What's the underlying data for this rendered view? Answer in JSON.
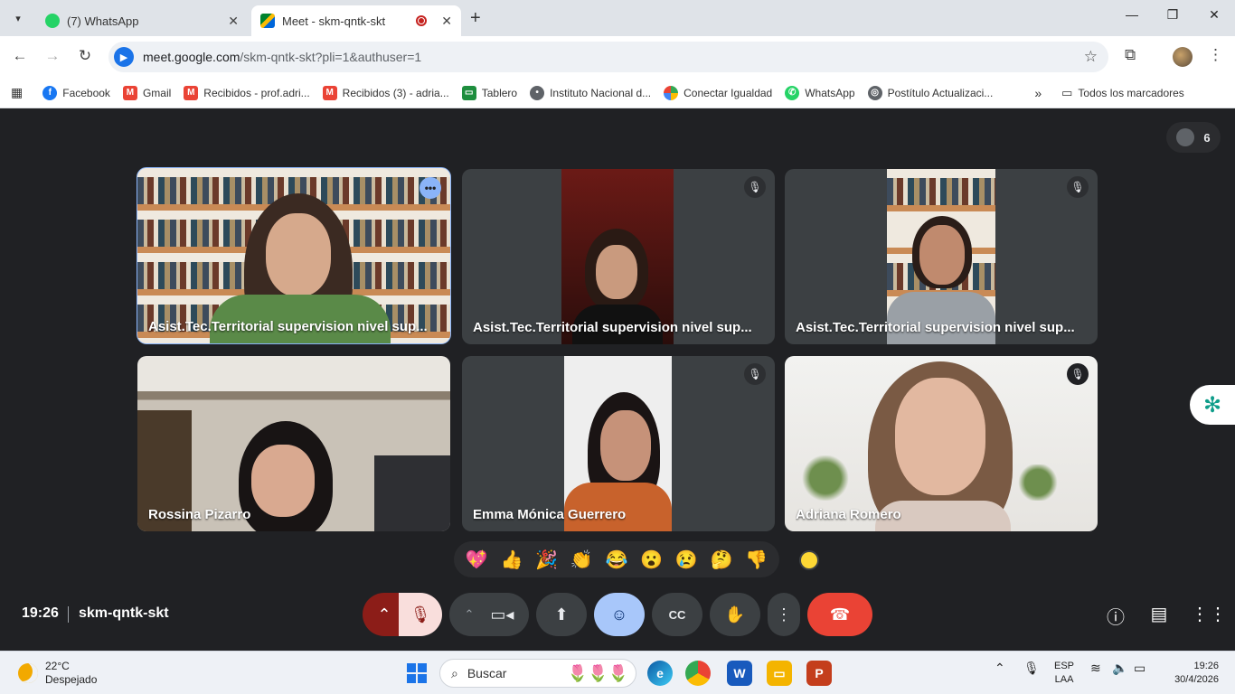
{
  "browser": {
    "tabs": [
      {
        "title": "(7) WhatsApp",
        "active": false
      },
      {
        "title": "Meet - skm-qntk-skt",
        "active": true
      }
    ],
    "url_host": "meet.google.com",
    "url_rest": "/skm-qntk-skt?pli=1&authuser=1",
    "bookmarks": [
      {
        "label": "Facebook",
        "icon": "facebook-icon",
        "color": "#1877f2"
      },
      {
        "label": "Gmail",
        "icon": "gmail-icon",
        "color": "#ea4335"
      },
      {
        "label": "Recibidos - prof.adri...",
        "icon": "gmail-icon",
        "color": "#ea4335"
      },
      {
        "label": "Recibidos (3) - adria...",
        "icon": "gmail-icon",
        "color": "#ea4335"
      },
      {
        "label": "Tablero",
        "icon": "classroom-icon",
        "color": "#1e8e3e"
      },
      {
        "label": "Instituto Nacional d...",
        "icon": "institution-icon",
        "color": "#5f6368"
      },
      {
        "label": "Conectar Igualdad",
        "icon": "conectar-icon",
        "color": "#34a853"
      },
      {
        "label": "WhatsApp",
        "icon": "whatsapp-icon",
        "color": "#25d366"
      },
      {
        "label": "Postítulo Actualizaci...",
        "icon": "globe-icon",
        "color": "#5f6368"
      }
    ],
    "all_bookmarks": "Todos los marcadores"
  },
  "meet": {
    "participant_count": "6",
    "tiles": [
      {
        "name": "Asist.Tec.Territorial supervision nivel sup...",
        "muted": false,
        "speaking": true
      },
      {
        "name": "Asist.Tec.Territorial supervision nivel sup...",
        "muted": true,
        "speaking": false
      },
      {
        "name": "Asist.Tec.Territorial supervision nivel sup...",
        "muted": true,
        "speaking": false
      },
      {
        "name": "Rossina Pizarro",
        "muted": false,
        "speaking": false
      },
      {
        "name": "Emma Mónica Guerrero",
        "muted": true,
        "speaking": false
      },
      {
        "name": "Adriana Romero",
        "muted": true,
        "speaking": false
      }
    ],
    "reactions": [
      "💖",
      "👍",
      "🎉",
      "👏",
      "😂",
      "😮",
      "😢",
      "🤔",
      "👎"
    ],
    "time": "19:26",
    "meeting_code": "skm-qntk-skt"
  },
  "taskbar": {
    "temperature": "22°C",
    "weather": "Despejado",
    "search_placeholder": "Buscar",
    "lang_top": "ESP",
    "lang_bottom": "LAA",
    "clock_time": "19:26",
    "clock_date": "30/4/2026"
  },
  "colors": {
    "meet_bg": "#202124",
    "hangup": "#ea4335",
    "active_blue": "#8ab4f8"
  }
}
